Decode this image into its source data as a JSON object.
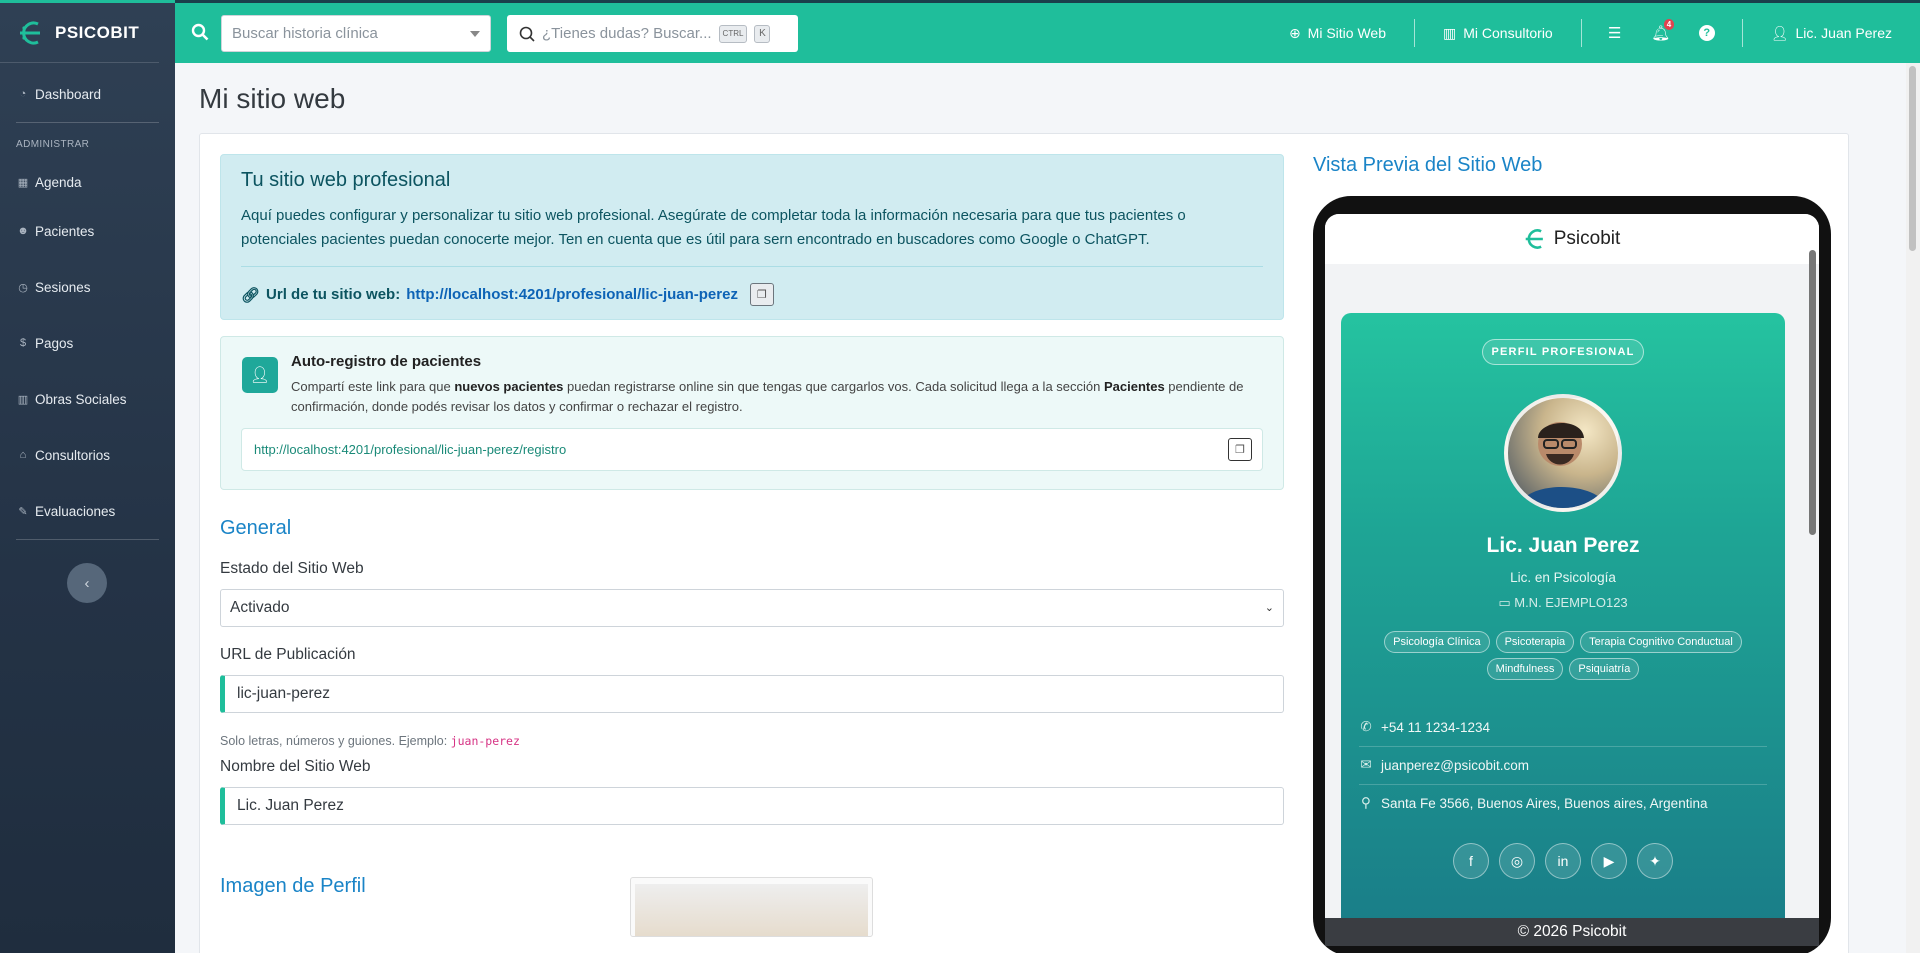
{
  "brand": {
    "name": "PSICOBIT",
    "accent": "#1fbe9b"
  },
  "sidebar": {
    "items": [
      {
        "label": "Dashboard",
        "icon": "dashboard-icon"
      },
      {
        "label": "Agenda",
        "icon": "calendar-icon"
      },
      {
        "label": "Pacientes",
        "icon": "users-icon"
      },
      {
        "label": "Sesiones",
        "icon": "clock-icon"
      },
      {
        "label": "Pagos",
        "icon": "dollar-icon"
      },
      {
        "label": "Obras Sociales",
        "icon": "building-icon"
      },
      {
        "label": "Consultorios",
        "icon": "home-icon"
      },
      {
        "label": "Evaluaciones",
        "icon": "pencil-icon"
      }
    ],
    "section_header": "ADMINISTRAR"
  },
  "topbar": {
    "search_placeholder": "Buscar historia clínica",
    "help_placeholder": "¿Tienes dudas? Buscar...",
    "kbd_ctrl": "CTRL",
    "kbd_k": "K",
    "mi_sitio": "Mi Sitio Web",
    "mi_consultorio": "Mi Consultorio",
    "notif_count": "4",
    "user": "Lic. Juan Perez"
  },
  "page": {
    "title": "Mi sitio web",
    "info": {
      "title": "Tu sitio web profesional",
      "body": "Aquí puedes configurar y personalizar tu sitio web profesional. Asegúrate de completar toda la información necesaria para que tus pacientes o potenciales pacientes puedan conocerte mejor. Ten en cuenta que es útil para sern encontrado en buscadores como Google o ChatGPT.",
      "url_label": "Url de tu sitio web:",
      "url": "http://localhost:4201/profesional/lic-juan-perez"
    },
    "auto": {
      "title": "Auto-registro de pacientes",
      "desc_1": "Compartí este link para que ",
      "desc_b1": "nuevos pacientes",
      "desc_2": " puedan registrarse online sin que tengas que cargarlos vos. Cada solicitud llega a la sección ",
      "desc_b2": "Pacientes",
      "desc_3": " pendiente de confirmación, donde podés revisar los datos y confirmar o rechazar el registro.",
      "link": "http://localhost:4201/profesional/lic-juan-perez/registro"
    },
    "general": {
      "section": "General",
      "estado_label": "Estado del Sitio Web",
      "estado_value": "Activado",
      "url_label": "URL de Publicación",
      "url_value": "lic-juan-perez",
      "url_help": "Solo letras, números y guiones. Ejemplo: ",
      "url_help_code": "juan-perez",
      "nombre_label": "Nombre del Sitio Web",
      "nombre_value": "Lic. Juan Perez"
    },
    "imagen": {
      "section": "Imagen de Perfil"
    }
  },
  "preview": {
    "title": "Vista Previa del Sitio Web",
    "brand": "Psicobit",
    "badge": "PERFIL PROFESIONAL",
    "name": "Lic. Juan Perez",
    "degree": "Lic. en Psicología",
    "license": "M.N. EJEMPLO123",
    "tags": [
      "Psicología Clínica",
      "Psicoterapia",
      "Terapia Cognitivo Conductual",
      "Mindfulness",
      "Psiquiatría"
    ],
    "phone": "+54 11 1234-1234",
    "email": "juanperez@psicobit.com",
    "address": "Santa Fe 3566, Buenos Aires, Buenos aires, Argentina",
    "footer": "© 2026 Psicobit"
  }
}
